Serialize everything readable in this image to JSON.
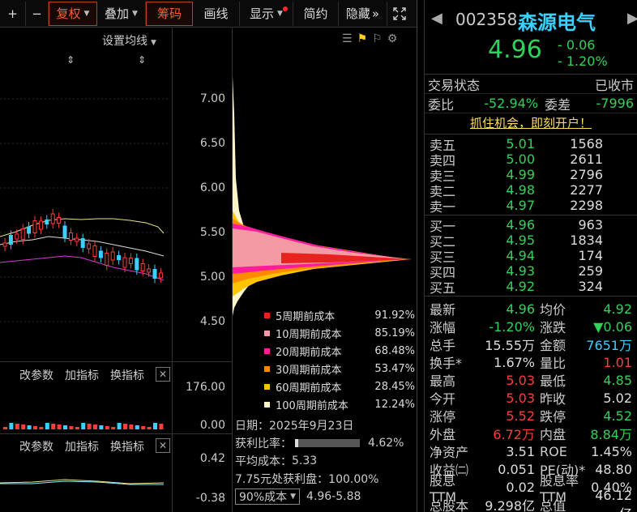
{
  "toolbar": {
    "plus": "+",
    "minus": "−",
    "fuquan": "复权",
    "diejia": "叠加",
    "chouma": "筹码",
    "huaxian": "画线",
    "xianshi": "显示",
    "jianyue": "简约",
    "yincang": "隐藏",
    "more": "»"
  },
  "kline": {
    "set_ma": "设置均线",
    "panel1": {
      "a": "改参数",
      "b": "加指标",
      "c": "换指标"
    },
    "panel2": {
      "a": "改参数",
      "b": "加指标",
      "c": "换指标"
    },
    "vol_ticks": [
      "176.00",
      "0.00"
    ],
    "ind_ticks": [
      "0.42",
      "-0.38"
    ]
  },
  "price_axis": [
    "7.00",
    "6.50",
    "6.00",
    "5.50",
    "5.00",
    "4.50"
  ],
  "cost_legend": [
    {
      "name": "5周期前成本",
      "value": "91.92%",
      "color": "#e8231f"
    },
    {
      "name": "10周期前成本",
      "value": "85.19%",
      "color": "#f39aa4"
    },
    {
      "name": "20周期前成本",
      "value": "68.48%",
      "color": "#ff1c9c"
    },
    {
      "name": "30周期前成本",
      "value": "53.47%",
      "color": "#ff8a00"
    },
    {
      "name": "60周期前成本",
      "value": "28.45%",
      "color": "#ffc400"
    },
    {
      "name": "100周期前成本",
      "value": "12.24%",
      "color": "#fff5c8"
    }
  ],
  "chip_info": {
    "date_label": "日期：",
    "date": "2025年9月23日",
    "profit_label": "获利比率：",
    "profit": "4.62%",
    "profit_fraction": 0.0462,
    "avg_label": "平均成本：",
    "avg": "5.33",
    "price_profit": "7.75元处获利盘：100.00%",
    "cost_select": "90%成本",
    "cost_range": "4.96-5.88"
  },
  "quote": {
    "code": "002358",
    "name": "森源电气",
    "price": "4.96",
    "change": "- 0.06",
    "change_pct": "- 1.20%",
    "trade_status_label": "交易状态",
    "trade_status": "已收市",
    "weibi_label": "委比",
    "weibi": "-52.94%",
    "weicha_label": "委差",
    "weicha": "-7996",
    "open_account": "抓住机会，即刻开户！",
    "sells": [
      {
        "label": "卖五",
        "price": "5.01",
        "vol": "1568"
      },
      {
        "label": "卖四",
        "price": "5.00",
        "vol": "2611"
      },
      {
        "label": "卖三",
        "price": "4.99",
        "vol": "2796"
      },
      {
        "label": "卖二",
        "price": "4.98",
        "vol": "2277"
      },
      {
        "label": "卖一",
        "price": "4.97",
        "vol": "2298"
      }
    ],
    "buys": [
      {
        "label": "买一",
        "price": "4.96",
        "vol": "963"
      },
      {
        "label": "买二",
        "price": "4.95",
        "vol": "1834"
      },
      {
        "label": "买三",
        "price": "4.94",
        "vol": "174"
      },
      {
        "label": "买四",
        "price": "4.93",
        "vol": "259"
      },
      {
        "label": "买五",
        "price": "4.92",
        "vol": "324"
      }
    ],
    "stats": [
      {
        "l1": "最新",
        "v1": "4.96",
        "c1": "g",
        "l2": "均价",
        "v2": "4.92",
        "c2": "g"
      },
      {
        "l1": "涨幅",
        "v1": "-1.20%",
        "c1": "g",
        "l2": "涨跌",
        "v2": "▼0.06",
        "c2": "g"
      },
      {
        "l1": "总手",
        "v1": "15.55万",
        "c1": "w",
        "l2": "金额",
        "v2": "7651万",
        "c2": "c"
      },
      {
        "l1": "换手*",
        "v1": "1.67%",
        "c1": "w",
        "l2": "量比",
        "v2": "1.01",
        "c2": "r"
      },
      {
        "l1": "最高",
        "v1": "5.03",
        "c1": "r",
        "l2": "最低",
        "v2": "4.85",
        "c2": "g"
      },
      {
        "l1": "今开",
        "v1": "5.03",
        "c1": "r",
        "l2": "昨收",
        "v2": "5.02",
        "c2": "w"
      },
      {
        "l1": "涨停",
        "v1": "5.52",
        "c1": "r",
        "l2": "跌停",
        "v2": "4.52",
        "c2": "g"
      },
      {
        "l1": "外盘",
        "v1": "6.72万",
        "c1": "r",
        "l2": "内盘",
        "v2": "8.84万",
        "c2": "g"
      },
      {
        "l1": "净资产",
        "v1": "3.51",
        "c1": "w",
        "l2": "ROE",
        "v2": "1.45%",
        "c2": "w"
      },
      {
        "l1": "收益㈡",
        "v1": "0.051",
        "c1": "w",
        "l2": "PE(动)*",
        "v2": "48.80",
        "c2": "w"
      },
      {
        "l1": "股息TTM",
        "v1": "0.02",
        "c1": "w",
        "l2": "股息率TTM",
        "v2": "0.40%",
        "c2": "w"
      },
      {
        "l1": "总股本",
        "v1": "9.298亿",
        "c1": "w",
        "l2": "总值",
        "v2": "46.12亿",
        "c2": "w"
      }
    ]
  }
}
